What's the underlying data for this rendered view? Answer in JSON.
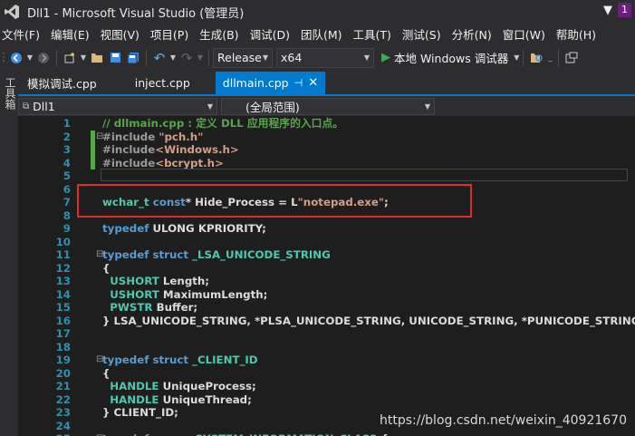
{
  "window": {
    "title": "Dll1 - Microsoft Visual Studio (管理员)",
    "notification_count": "1"
  },
  "menu": [
    "文件(F)",
    "编辑(E)",
    "视图(V)",
    "项目(P)",
    "生成(B)",
    "调试(D)",
    "团队(M)",
    "工具(T)",
    "测试(S)",
    "分析(N)",
    "窗口(W)",
    "帮助(H)"
  ],
  "toolbar": {
    "configuration": "Release",
    "platform": "x64",
    "run_label": "本地 Windows 调试器"
  },
  "toolstrip": {
    "label": "工具箱"
  },
  "tabs": [
    {
      "label": "模拟调试.cpp",
      "active": false
    },
    {
      "label": "inject.cpp",
      "active": false
    },
    {
      "label": "dllmain.cpp",
      "active": true
    }
  ],
  "navbar": {
    "project": "Dll1",
    "scope": "(全局范围)"
  },
  "code_lines": [
    {
      "n": "1",
      "fold": "",
      "tokens": [
        [
          "comment",
          "// dllmain.cpp : 定义 DLL 应用程序的入口点。"
        ]
      ]
    },
    {
      "n": "2",
      "fold": "⊟",
      "tokens": [
        [
          "pp",
          "#include "
        ],
        [
          "str",
          "\"pch.h\""
        ]
      ]
    },
    {
      "n": "3",
      "fold": "",
      "tokens": [
        [
          "pp",
          "#include"
        ],
        [
          "str",
          "<Windows.h>"
        ]
      ]
    },
    {
      "n": "4",
      "fold": "",
      "tokens": [
        [
          "pp",
          "#include"
        ],
        [
          "str",
          "<bcrypt.h>"
        ]
      ]
    },
    {
      "n": "5",
      "fold": "",
      "tokens": []
    },
    {
      "n": "6",
      "fold": "",
      "tokens": []
    },
    {
      "n": "7",
      "fold": "",
      "tokens": [
        [
          "type",
          "wchar_t "
        ],
        [
          "kw",
          "const"
        ],
        [
          "txt",
          "* Hide_Process = L"
        ],
        [
          "str",
          "\"notepad.exe\""
        ],
        [
          "txt",
          ";"
        ]
      ]
    },
    {
      "n": "8",
      "fold": "",
      "tokens": []
    },
    {
      "n": "9",
      "fold": "",
      "tokens": [
        [
          "kw",
          "typedef "
        ],
        [
          "txt",
          "ULONG KPRIORITY;"
        ]
      ]
    },
    {
      "n": "10",
      "fold": "",
      "tokens": []
    },
    {
      "n": "11",
      "fold": "⊟",
      "tokens": [
        [
          "kw",
          "typedef struct "
        ],
        [
          "type",
          "_LSA_UNICODE_STRING"
        ]
      ]
    },
    {
      "n": "12",
      "fold": "",
      "tokens": [
        [
          "txt",
          "{"
        ]
      ]
    },
    {
      "n": "13",
      "fold": "",
      "tokens": [
        [
          "txt",
          "  "
        ],
        [
          "type",
          "USHORT "
        ],
        [
          "txt",
          "Length;"
        ]
      ]
    },
    {
      "n": "14",
      "fold": "",
      "tokens": [
        [
          "txt",
          "  "
        ],
        [
          "type",
          "USHORT "
        ],
        [
          "txt",
          "MaximumLength;"
        ]
      ]
    },
    {
      "n": "15",
      "fold": "",
      "tokens": [
        [
          "txt",
          "  "
        ],
        [
          "type",
          "PWSTR "
        ],
        [
          "txt",
          "Buffer;"
        ]
      ]
    },
    {
      "n": "16",
      "fold": "",
      "tokens": [
        [
          "txt",
          "} LSA_UNICODE_STRING, *PLSA_UNICODE_STRING, UNICODE_STRING, *PUNICODE_STRING;"
        ]
      ]
    },
    {
      "n": "17",
      "fold": "",
      "tokens": []
    },
    {
      "n": "18",
      "fold": "",
      "tokens": []
    },
    {
      "n": "19",
      "fold": "⊟",
      "tokens": [
        [
          "kw",
          "typedef struct "
        ],
        [
          "type",
          "_CLIENT_ID"
        ]
      ]
    },
    {
      "n": "20",
      "fold": "",
      "tokens": [
        [
          "txt",
          "{"
        ]
      ]
    },
    {
      "n": "21",
      "fold": "",
      "tokens": [
        [
          "txt",
          "  "
        ],
        [
          "type",
          "HANDLE "
        ],
        [
          "txt",
          "UniqueProcess;"
        ]
      ]
    },
    {
      "n": "22",
      "fold": "",
      "tokens": [
        [
          "txt",
          "  "
        ],
        [
          "type",
          "HANDLE "
        ],
        [
          "txt",
          "UniqueThread;"
        ]
      ]
    },
    {
      "n": "23",
      "fold": "",
      "tokens": [
        [
          "txt",
          "} CLIENT_ID;"
        ]
      ]
    },
    {
      "n": "24",
      "fold": "",
      "tokens": []
    },
    {
      "n": "25",
      "fold": "⊟",
      "tokens": [
        [
          "kw",
          "typedef enum "
        ],
        [
          "type",
          "_SYSTEM_INFORMATION_CLASS "
        ],
        [
          "txt",
          "{"
        ]
      ]
    }
  ],
  "watermark": "https://blog.csdn.net/weixin_40921670",
  "colors": {
    "accent": "#007acc",
    "highlight_box": "#e02b2b",
    "comment": "#57a64a",
    "keyword": "#569cd6",
    "type": "#4ec9b0",
    "string": "#d69d85",
    "line_number": "#2b91af"
  }
}
